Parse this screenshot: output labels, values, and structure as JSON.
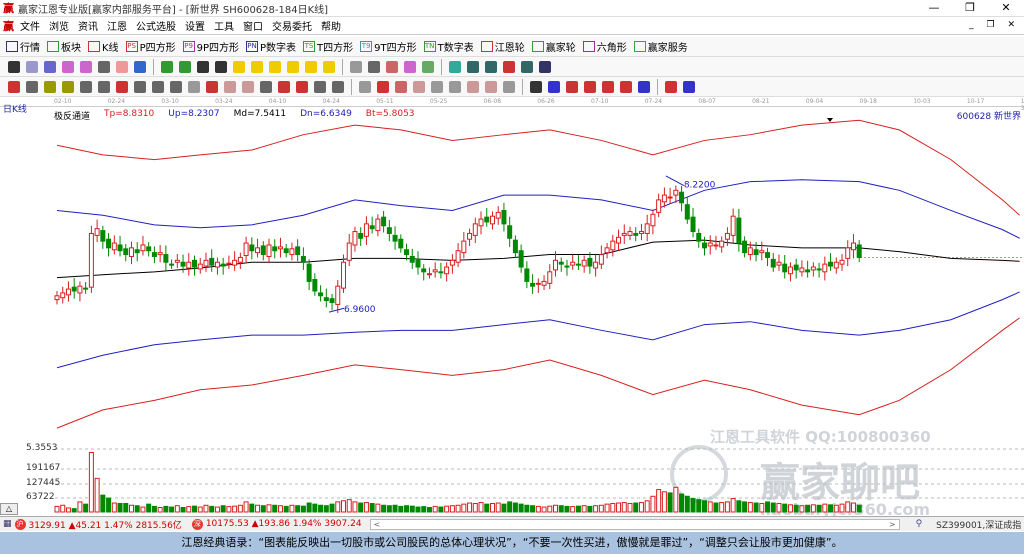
{
  "window": {
    "title": "赢家江恩专业版[赢家内部服务平台] - [新世界  SH600628-184日K线]",
    "min": "—",
    "max": "❐",
    "close": "✕"
  },
  "menu": [
    "文件",
    "浏览",
    "资讯",
    "江恩",
    "公式选股",
    "设置",
    "工具",
    "窗口",
    "交易委托",
    "帮助"
  ],
  "toolbar": [
    {
      "icon": "grid-icon",
      "label": "行情"
    },
    {
      "icon": "blocks-icon",
      "label": "板块"
    },
    {
      "icon": "candles-icon",
      "label": "K线"
    },
    {
      "icon": "PS",
      "label": "P四方形"
    },
    {
      "icon": "P9",
      "label": "9P四方形"
    },
    {
      "icon": "PN",
      "label": "P数字表"
    },
    {
      "icon": "TS",
      "label": "T四方形"
    },
    {
      "icon": "T9",
      "label": "9T四方形"
    },
    {
      "icon": "TN",
      "label": "T数字表"
    },
    {
      "icon": "target-icon",
      "label": "江恩轮"
    },
    {
      "icon": "wheel-icon",
      "label": "赢家轮"
    },
    {
      "icon": "hexagon-icon",
      "label": "六角形"
    },
    {
      "icon": "dollar-icon",
      "label": "赢家服务"
    }
  ],
  "period_label": "日K线",
  "date_ticks": [
    "02-10",
    "02-24",
    "03-10",
    "03-24",
    "04-10",
    "04-24",
    "05-11",
    "05-25",
    "06-08",
    "06-26",
    "07-10",
    "07-24",
    "08-07",
    "08-21",
    "09-04",
    "09-18",
    "10-03",
    "10-17",
    "10-31"
  ],
  "indicator": {
    "name": "极反通道",
    "tp": "Tp=8.8310",
    "up": "Up=8.2307",
    "md": "Md=7.5411",
    "dn": "Dn=6.6349",
    "bt": "Bt=5.8053"
  },
  "stock_label": "600628  新世界",
  "colors": {
    "up": "#d81e1e",
    "down": "#008800",
    "band_outer": "#d82020",
    "band_inner": "#2020c0",
    "mid": "#000000"
  },
  "annotations": {
    "high": "8.2200",
    "low": "6.9600"
  },
  "chart_data": {
    "type": "candlestick",
    "closes": [
      7.05,
      7.08,
      7.12,
      7.1,
      7.15,
      7.12,
      7.7,
      7.75,
      7.62,
      7.55,
      7.6,
      7.52,
      7.48,
      7.55,
      7.5,
      7.58,
      7.52,
      7.46,
      7.5,
      7.4,
      7.38,
      7.42,
      7.36,
      7.4,
      7.35,
      7.38,
      7.42,
      7.37,
      7.4,
      7.36,
      7.39,
      7.42,
      7.45,
      7.6,
      7.52,
      7.55,
      7.48,
      7.58,
      7.52,
      7.56,
      7.5,
      7.54,
      7.48,
      7.4,
      7.2,
      7.1,
      7.05,
      7.0,
      6.98,
      7.15,
      7.4,
      7.6,
      7.72,
      7.65,
      7.8,
      7.75,
      7.85,
      7.78,
      7.7,
      7.62,
      7.55,
      7.48,
      7.4,
      7.35,
      7.3,
      7.28,
      7.32,
      7.3,
      7.35,
      7.42,
      7.52,
      7.62,
      7.7,
      7.8,
      7.85,
      7.82,
      7.88,
      7.92,
      7.8,
      7.65,
      7.5,
      7.35,
      7.2,
      7.15,
      7.18,
      7.2,
      7.3,
      7.42,
      7.38,
      7.35,
      7.4,
      7.38,
      7.42,
      7.36,
      7.4,
      7.48,
      7.55,
      7.62,
      7.66,
      7.7,
      7.72,
      7.68,
      7.72,
      7.8,
      7.9,
      8.05,
      8.1,
      8.08,
      8.15,
      8.02,
      7.85,
      7.72,
      7.62,
      7.55,
      7.6,
      7.58,
      7.62,
      7.7,
      7.88,
      7.6,
      7.5,
      7.55,
      7.48,
      7.52,
      7.45,
      7.35,
      7.4,
      7.3,
      7.35,
      7.32,
      7.34,
      7.3,
      7.35,
      7.32,
      7.38,
      7.36,
      7.4,
      7.42,
      7.55,
      7.6,
      7.45
    ],
    "volumes": [
      25000,
      30000,
      18000,
      15000,
      45000,
      35000,
      265000,
      150000,
      75000,
      62000,
      40000,
      38000,
      38000,
      30000,
      28000,
      22000,
      35000,
      25000,
      20000,
      25000,
      22000,
      28000,
      20000,
      24000,
      26000,
      22000,
      30000,
      25000,
      22000,
      28000,
      24000,
      26000,
      30000,
      45000,
      35000,
      30000,
      28000,
      32000,
      30000,
      28000,
      25000,
      30000,
      28000,
      26000,
      40000,
      35000,
      30000,
      28000,
      35000,
      45000,
      50000,
      55000,
      45000,
      40000,
      42000,
      38000,
      35000,
      30000,
      28000,
      30000,
      25000,
      28000,
      26000,
      22000,
      24000,
      20000,
      25000,
      22000,
      26000,
      28000,
      30000,
      35000,
      40000,
      38000,
      42000,
      35000,
      38000,
      40000,
      35000,
      45000,
      40000,
      35000,
      30000,
      28000,
      25000,
      22000,
      26000,
      30000,
      28000,
      25000,
      24000,
      26000,
      28000,
      25000,
      28000,
      30000,
      35000,
      38000,
      40000,
      42000,
      38000,
      40000,
      42000,
      50000,
      70000,
      100000,
      90000,
      85000,
      110000,
      80000,
      70000,
      60000,
      55000,
      50000,
      45000,
      40000,
      42000,
      45000,
      60000,
      50000,
      45000,
      42000,
      40000,
      38000,
      45000,
      40000,
      38000,
      35000,
      32000,
      30000,
      28000,
      30000,
      32000,
      30000,
      35000,
      32000,
      30000,
      35000,
      45000,
      40000,
      30000
    ],
    "bands": {
      "index": [
        0,
        8,
        17,
        25,
        34,
        43,
        52,
        60,
        69,
        78,
        86,
        95,
        104,
        113,
        121,
        130,
        140,
        147,
        156,
        165,
        168
      ],
      "tp": [
        8.62,
        8.52,
        8.47,
        8.52,
        8.57,
        8.73,
        8.83,
        8.78,
        8.67,
        8.73,
        8.78,
        8.67,
        8.52,
        8.67,
        8.73,
        8.83,
        8.88,
        8.78,
        8.47,
        8.05,
        7.89
      ],
      "up": [
        7.94,
        7.89,
        7.79,
        7.76,
        7.79,
        7.89,
        8.05,
        7.99,
        7.94,
        8.1,
        8.1,
        8.05,
        7.94,
        8.15,
        8.24,
        8.26,
        8.24,
        8.15,
        7.94,
        7.74,
        7.65
      ],
      "md": [
        7.24,
        7.27,
        7.3,
        7.34,
        7.4,
        7.4,
        7.44,
        7.44,
        7.42,
        7.44,
        7.48,
        7.48,
        7.61,
        7.63,
        7.58,
        7.55,
        7.55,
        7.51,
        7.44,
        7.42,
        7.41
      ],
      "dn": [
        6.3,
        6.43,
        6.54,
        6.59,
        6.64,
        6.64,
        6.67,
        6.69,
        6.69,
        6.75,
        6.8,
        6.69,
        6.59,
        6.75,
        6.78,
        6.69,
        6.64,
        6.69,
        6.8,
        7.01,
        7.09
      ],
      "bt": [
        5.67,
        5.86,
        5.96,
        6.07,
        6.12,
        6.22,
        6.33,
        6.28,
        6.22,
        6.28,
        6.38,
        6.22,
        6.02,
        6.17,
        6.07,
        5.91,
        5.81,
        5.96,
        6.28,
        6.69,
        6.82
      ]
    },
    "volume_ticks": [
      "191167",
      "127445",
      "63722"
    ],
    "volume_tick_values": [
      191167,
      127445,
      63722
    ],
    "extra_price_label": "5.3553"
  },
  "status": {
    "sh": "3129.91 ▲45.21 1.47% 2815.56亿",
    "sz": "10175.53 ▲193.86 1.94% 3907.24",
    "sh_icon": "沪",
    "sz_icon": "深",
    "scroll_left": "<",
    "scroll_right": ">",
    "index": "SZ399001,深证成指"
  },
  "watermark": {
    "line1": "江恩工具软件  QQ:100800360",
    "line2": "赢家聊吧",
    "line3": "liaoba.yjcf360.com"
  },
  "banner": "江恩经典语录：“图表能反映出一切股市或公司股民的总体心理状况”，“不要一次性买进，傲慢就是罪过”，“调整只会让股市更加健康”。"
}
